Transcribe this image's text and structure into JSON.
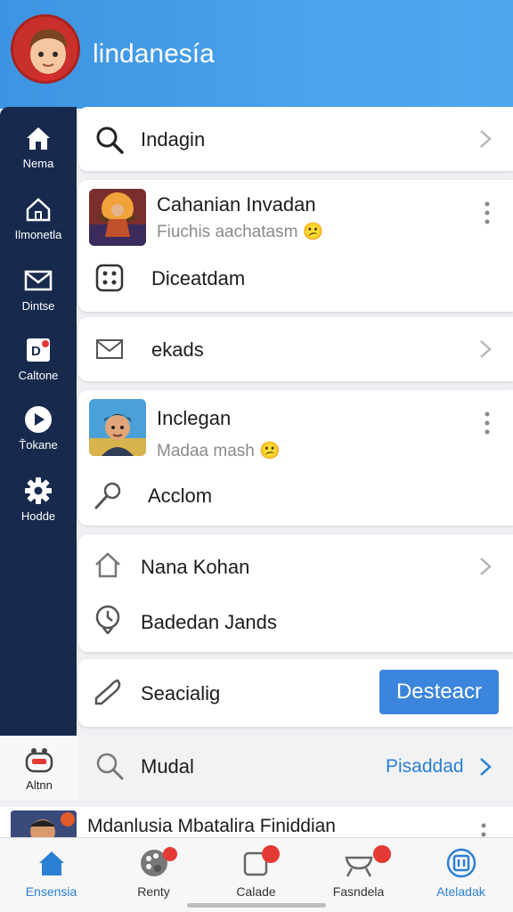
{
  "header": {
    "title": "lindanesía"
  },
  "sidebar": {
    "items": [
      {
        "label": "Nema",
        "icon": "home-icon"
      },
      {
        "label": "Ilmonetla",
        "icon": "house-outline-icon"
      },
      {
        "label": "Dintse",
        "icon": "mail-icon"
      },
      {
        "label": "Caltone",
        "icon": "d-badge-icon"
      },
      {
        "label": "Ťokane",
        "icon": "play-icon"
      },
      {
        "label": "Hodde",
        "icon": "gear-icon"
      }
    ],
    "bottom": {
      "label": "Altnn",
      "icon": "bot-icon"
    }
  },
  "search_row": {
    "label": "Indagin"
  },
  "card1": {
    "title": "Cahanian Invadan",
    "subtitle": "Fiuchis aachatasm 😕",
    "action": "Diceatdam"
  },
  "mail_row": {
    "label": "ekads"
  },
  "card2": {
    "title": "Inclegan",
    "subtitle": "Madaa mash 😕",
    "action": "Acclom"
  },
  "card3": {
    "item1": "Nana Kohan",
    "item2": "Badedan Jands"
  },
  "card4": {
    "label": "Seacialig",
    "button": "Desteacr"
  },
  "strip": {
    "label": "Mudal",
    "link": "Pisaddad"
  },
  "partial_row": {
    "title": "Mdanlusia Mbatalira Finiddian"
  },
  "tabbar": {
    "tabs": [
      {
        "label": "Ensensia",
        "icon": "home-icon",
        "active": true
      },
      {
        "label": "Renty",
        "icon": "palette-icon",
        "active": false
      },
      {
        "label": "Calade",
        "icon": "square-icon",
        "active": false
      },
      {
        "label": "Fasndela",
        "icon": "grill-icon",
        "active": false
      },
      {
        "label": "Ateladak",
        "icon": "target-icon",
        "active": true
      }
    ]
  },
  "colors": {
    "header": "#4aa3ec",
    "sidebar": "#172a4d",
    "accent": "#3b85dc",
    "link": "#2b7fd4"
  }
}
